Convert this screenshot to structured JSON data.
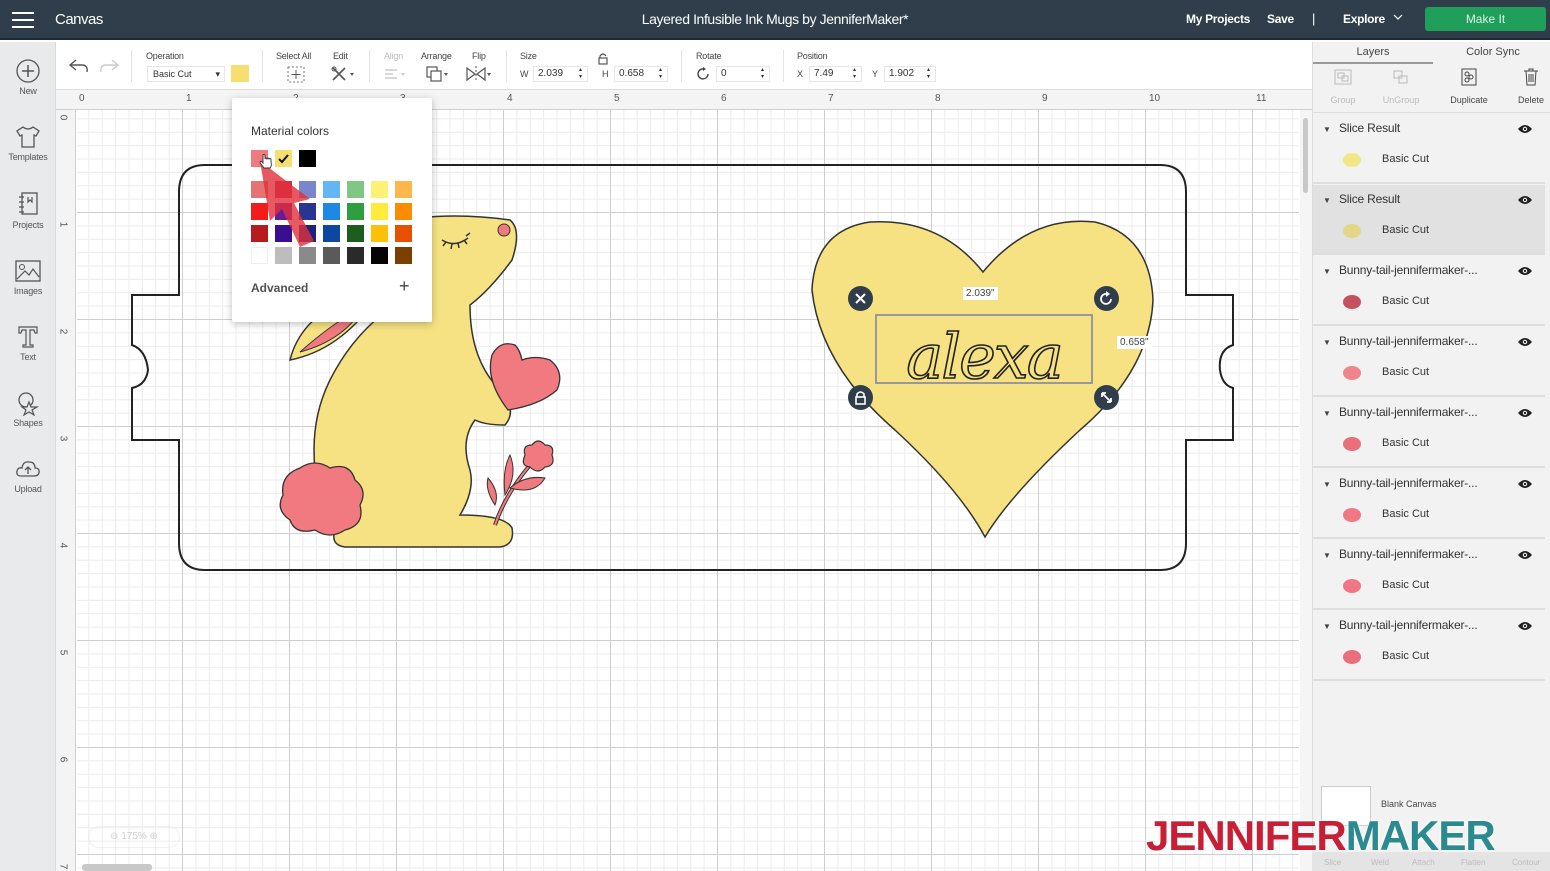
{
  "topbar": {
    "app_name": "Canvas",
    "project_title": "Layered Infusible Ink Mugs by JenniferMaker*",
    "my_projects": "My Projects",
    "save": "Save",
    "separator": "|",
    "explore": "Explore",
    "make_it": "Make It"
  },
  "sidebar": {
    "items": [
      {
        "label": "New",
        "icon": "plus-circle-icon"
      },
      {
        "label": "Templates",
        "icon": "shirt-icon"
      },
      {
        "label": "Projects",
        "icon": "notebook-icon"
      },
      {
        "label": "Images",
        "icon": "image-icon"
      },
      {
        "label": "Text",
        "icon": "text-icon"
      },
      {
        "label": "Shapes",
        "icon": "shapes-icon"
      },
      {
        "label": "Upload",
        "icon": "upload-cloud-icon"
      }
    ]
  },
  "toolbar": {
    "operation_label": "Operation",
    "operation_value": "Basic Cut",
    "swatch_color": "#f6de71",
    "select_all_label": "Select All",
    "edit_label": "Edit",
    "align_label": "Align",
    "arrange_label": "Arrange",
    "flip_label": "Flip",
    "size_label": "Size",
    "w_label": "W",
    "w_value": "2.039",
    "h_label": "H",
    "h_value": "0.658",
    "rotate_label": "Rotate",
    "rotate_value": "0",
    "position_label": "Position",
    "x_label": "X",
    "x_value": "7.49",
    "y_label": "Y",
    "y_value": "1.902"
  },
  "rulers": {
    "top": [
      "0",
      "1",
      "2",
      "3",
      "4",
      "5",
      "6",
      "7",
      "8",
      "9",
      "10",
      "11"
    ],
    "left": [
      "0",
      "1",
      "2",
      "3",
      "4",
      "5",
      "6",
      "7"
    ]
  },
  "zoom_level": "175%",
  "color_popup": {
    "title": "Material colors",
    "recent": [
      {
        "color": "#f07a80",
        "checked": false
      },
      {
        "color": "#f6de71",
        "checked": true
      },
      {
        "color": "#000000",
        "checked": false
      }
    ],
    "grid": [
      [
        "#e57373",
        "#d32f4a",
        "#7986cb",
        "#64b5f6",
        "#81c784",
        "#fff176",
        "#ffb74d"
      ],
      [
        "#f21c1c",
        "#6a1b9a",
        "#283593",
        "#1e88e5",
        "#2e9e3e",
        "#ffeb3b",
        "#fb8c00"
      ],
      [
        "#b71c1c",
        "#3a0f8f",
        "#1a237e",
        "#0d47a1",
        "#1b5e20",
        "#ffc107",
        "#e65100"
      ],
      [
        "#ffffff",
        "#bdbdbd",
        "#8a8a8a",
        "#5a5a5a",
        "#2a2a2a",
        "#050505",
        "#7b3f00"
      ]
    ],
    "advanced": "Advanced",
    "plus": "+"
  },
  "selection": {
    "text": "alexa",
    "width_label": "2.039\"",
    "height_label": "0.658\""
  },
  "right_panel": {
    "tabs": [
      "Layers",
      "Color Sync"
    ],
    "tools": [
      {
        "label": "Group",
        "enabled": false
      },
      {
        "label": "UnGroup",
        "enabled": false
      },
      {
        "label": "Duplicate",
        "enabled": true
      },
      {
        "label": "Delete",
        "enabled": true
      }
    ],
    "layers": [
      {
        "name": "Slice Result",
        "operation": "Basic Cut",
        "selected": false,
        "thumb": "#f2e37a"
      },
      {
        "name": "Slice Result",
        "operation": "Basic Cut",
        "selected": true,
        "thumb": "#e3d67d"
      },
      {
        "name": "Bunny-tail-jennifermaker-...",
        "operation": "Basic Cut",
        "selected": false,
        "thumb": "#c0404f"
      },
      {
        "name": "Bunny-tail-jennifermaker-...",
        "operation": "Basic Cut",
        "selected": false,
        "thumb": "#f07a80"
      },
      {
        "name": "Bunny-tail-jennifermaker-...",
        "operation": "Basic Cut",
        "selected": false,
        "thumb": "#e8616d"
      },
      {
        "name": "Bunny-tail-jennifermaker-...",
        "operation": "Basic Cut",
        "selected": false,
        "thumb": "#f06a78"
      },
      {
        "name": "Bunny-tail-jennifermaker-...",
        "operation": "Basic Cut",
        "selected": false,
        "thumb": "#f06a78"
      },
      {
        "name": "Bunny-tail-jennifermaker-...",
        "operation": "Basic Cut",
        "selected": false,
        "thumb": "#e8616d"
      }
    ],
    "blank_canvas": "Blank Canvas",
    "bottom_tools": [
      "Slice",
      "Weld",
      "Attach",
      "Flatten",
      "Contour"
    ]
  },
  "watermark": {
    "part1": "JENNIFER",
    "part2": "MAKER"
  }
}
